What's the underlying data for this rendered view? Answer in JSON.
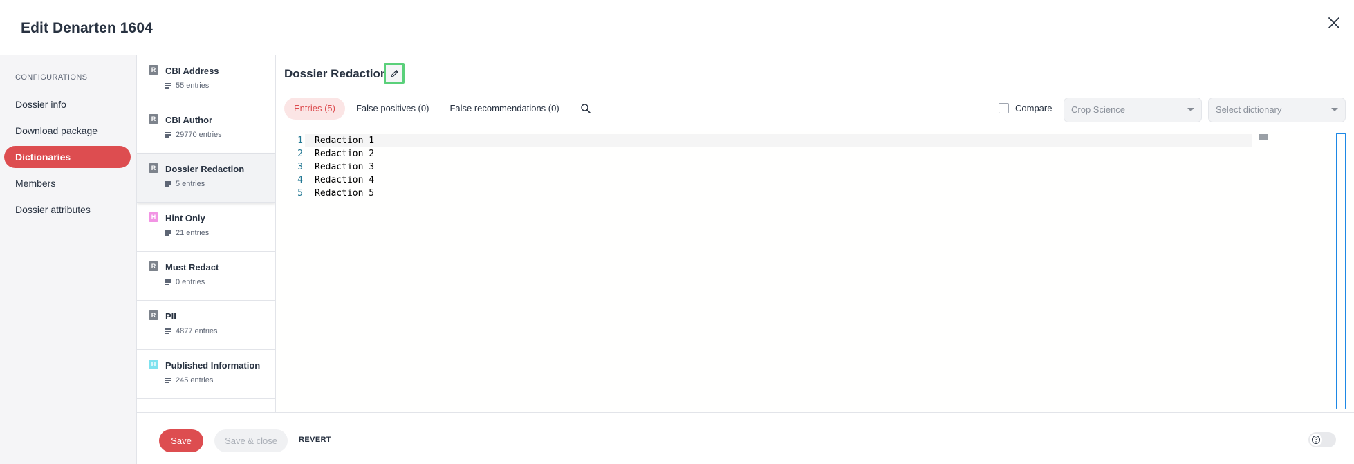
{
  "header": {
    "title": "Edit Denarten 1604"
  },
  "nav": {
    "section_label": "CONFIGURATIONS",
    "items": [
      {
        "label": "Dossier info"
      },
      {
        "label": "Download package"
      },
      {
        "label": "Dictionaries",
        "active": true
      },
      {
        "label": "Members"
      },
      {
        "label": "Dossier attributes"
      }
    ]
  },
  "dictionaries": [
    {
      "badge": "R",
      "badge_color": "#7d838c",
      "name": "CBI Address",
      "count": "55 entries"
    },
    {
      "badge": "R",
      "badge_color": "#7d838c",
      "name": "CBI Author",
      "count": "29770 entries"
    },
    {
      "badge": "R",
      "badge_color": "#7d838c",
      "name": "Dossier Redaction",
      "count": "5 entries",
      "active": true
    },
    {
      "badge": "H",
      "badge_color": "#f294e4",
      "name": "Hint Only",
      "count": "21 entries"
    },
    {
      "badge": "R",
      "badge_color": "#7d838c",
      "name": "Must Redact",
      "count": "0 entries"
    },
    {
      "badge": "R",
      "badge_color": "#7d838c",
      "name": "PII",
      "count": "4877 entries"
    },
    {
      "badge": "H",
      "badge_color": "#7ee2ef",
      "name": "Published Information",
      "count": "245 entries"
    }
  ],
  "main": {
    "title": "Dossier Redaction",
    "tabs": [
      {
        "label": "Entries (5)",
        "active": true
      },
      {
        "label": "False positives (0)"
      },
      {
        "label": "False recommendations (0)"
      }
    ],
    "compare_label": "Compare",
    "template_select": "Crop Science",
    "dictionary_select": "Select dictionary"
  },
  "editor": {
    "lines": [
      {
        "n": "1",
        "text": "Redaction 1"
      },
      {
        "n": "2",
        "text": "Redaction 2"
      },
      {
        "n": "3",
        "text": "Redaction 3"
      },
      {
        "n": "4",
        "text": "Redaction 4"
      },
      {
        "n": "5",
        "text": "Redaction 5"
      }
    ]
  },
  "footer": {
    "save": "Save",
    "save_close": "Save & close",
    "revert": "REVERT"
  },
  "colors": {
    "accent": "#dd4d50",
    "highlight_border": "#5ad07a"
  }
}
